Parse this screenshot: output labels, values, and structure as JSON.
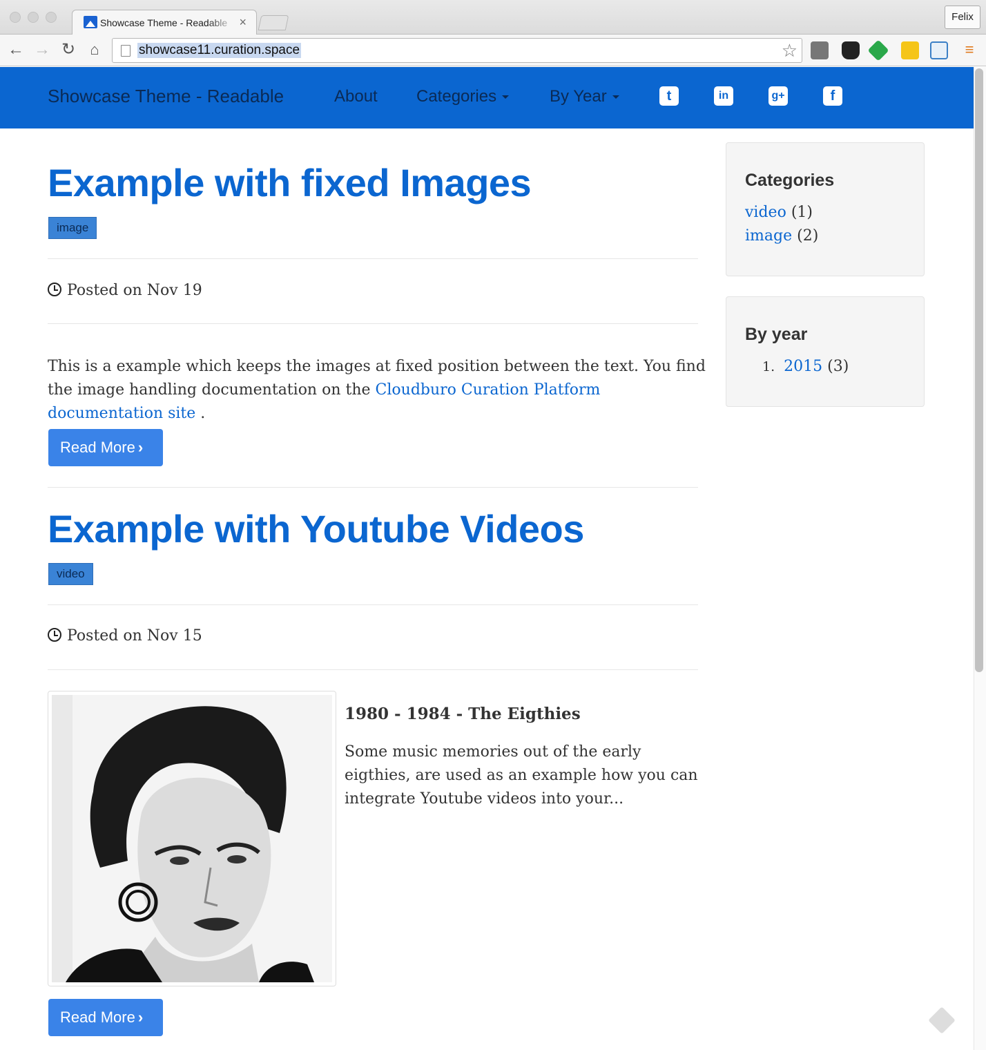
{
  "browser": {
    "tab_title": "Showcase Theme - Readable",
    "tab_close": "×",
    "profile_name": "Felix",
    "url": "showcase11.curation.space"
  },
  "navbar": {
    "brand": "Showcase Theme - Readable",
    "links": {
      "about": "About",
      "categories": "Categories",
      "by_year": "By Year"
    },
    "social": {
      "twitter": "t",
      "linkedin": "in",
      "googleplus": "g+",
      "facebook": "f"
    }
  },
  "posts": [
    {
      "title": "Example with fixed Images",
      "tag": "image",
      "posted": "Posted on Nov 19",
      "excerpt_before": "This is a example which keeps the images at fixed position between the text. You find the image handling documentation on the ",
      "excerpt_link": "Cloudburo Curation Platform documentation site",
      "excerpt_after": " .",
      "excerpt_ellipsis": "...",
      "read_more": "Read More"
    },
    {
      "title": "Example with Youtube Videos",
      "tag": "video",
      "posted": "Posted on Nov 15",
      "image_heading": "1980 - 1984 - The Eigthies",
      "excerpt": "Some music memories out of the early eigthies, are used as an example how you can integrate Youtube videos into your...",
      "read_more": "Read More"
    }
  ],
  "sidebar": {
    "categories": {
      "title": "Categories",
      "items": [
        {
          "label": "video",
          "count": "(1)"
        },
        {
          "label": "image",
          "count": "(2)"
        }
      ]
    },
    "by_year": {
      "title": "By year",
      "items": [
        {
          "marker": "1.",
          "label": "2015",
          "count": "(3)"
        }
      ]
    }
  },
  "colors": {
    "accent": "#0b66d0",
    "navbar_text": "#0a2a55",
    "button": "#3a83e8"
  }
}
